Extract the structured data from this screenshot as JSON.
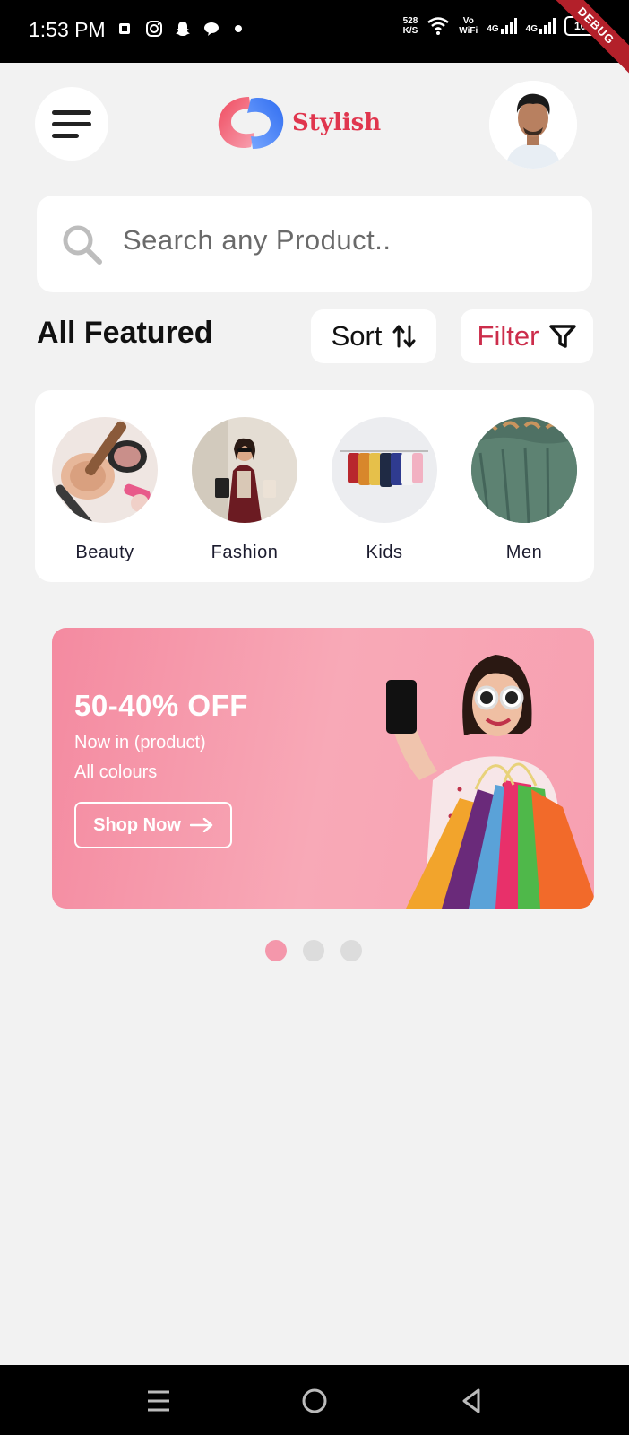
{
  "status_bar": {
    "time": "1:53 PM",
    "net_speed_value": "528",
    "net_speed_unit": "K/S",
    "vowifi_top": "Vo",
    "vowifi_bottom": "WiFi",
    "signal1": "4G",
    "signal2": "4G",
    "battery": "100",
    "debug_banner": "DEBUG"
  },
  "header": {
    "logo_text": "Stylish"
  },
  "search": {
    "placeholder": "Search any Product.."
  },
  "featured": {
    "title": "All Featured",
    "sort_label": "Sort",
    "filter_label": "Filter"
  },
  "categories": [
    {
      "label": "Beauty"
    },
    {
      "label": "Fashion"
    },
    {
      "label": "Kids"
    },
    {
      "label": "Men"
    }
  ],
  "banner": {
    "title": "50-40% OFF",
    "line1": "Now in (product)",
    "line2": "All colours",
    "button_label": "Shop Now",
    "bg_color": "#f8a0b3"
  },
  "carousel": {
    "pages": 3,
    "active_index": 0
  },
  "colors": {
    "accent": "#e0364e",
    "filter_text": "#cc2d4b",
    "dot_active": "#f497ab",
    "background": "#f2f2f2"
  },
  "icons": {
    "menu": "menu-icon",
    "search": "search-icon",
    "sort": "sort-arrows-icon",
    "filter": "funnel-icon",
    "arrow": "arrow-right-icon"
  }
}
